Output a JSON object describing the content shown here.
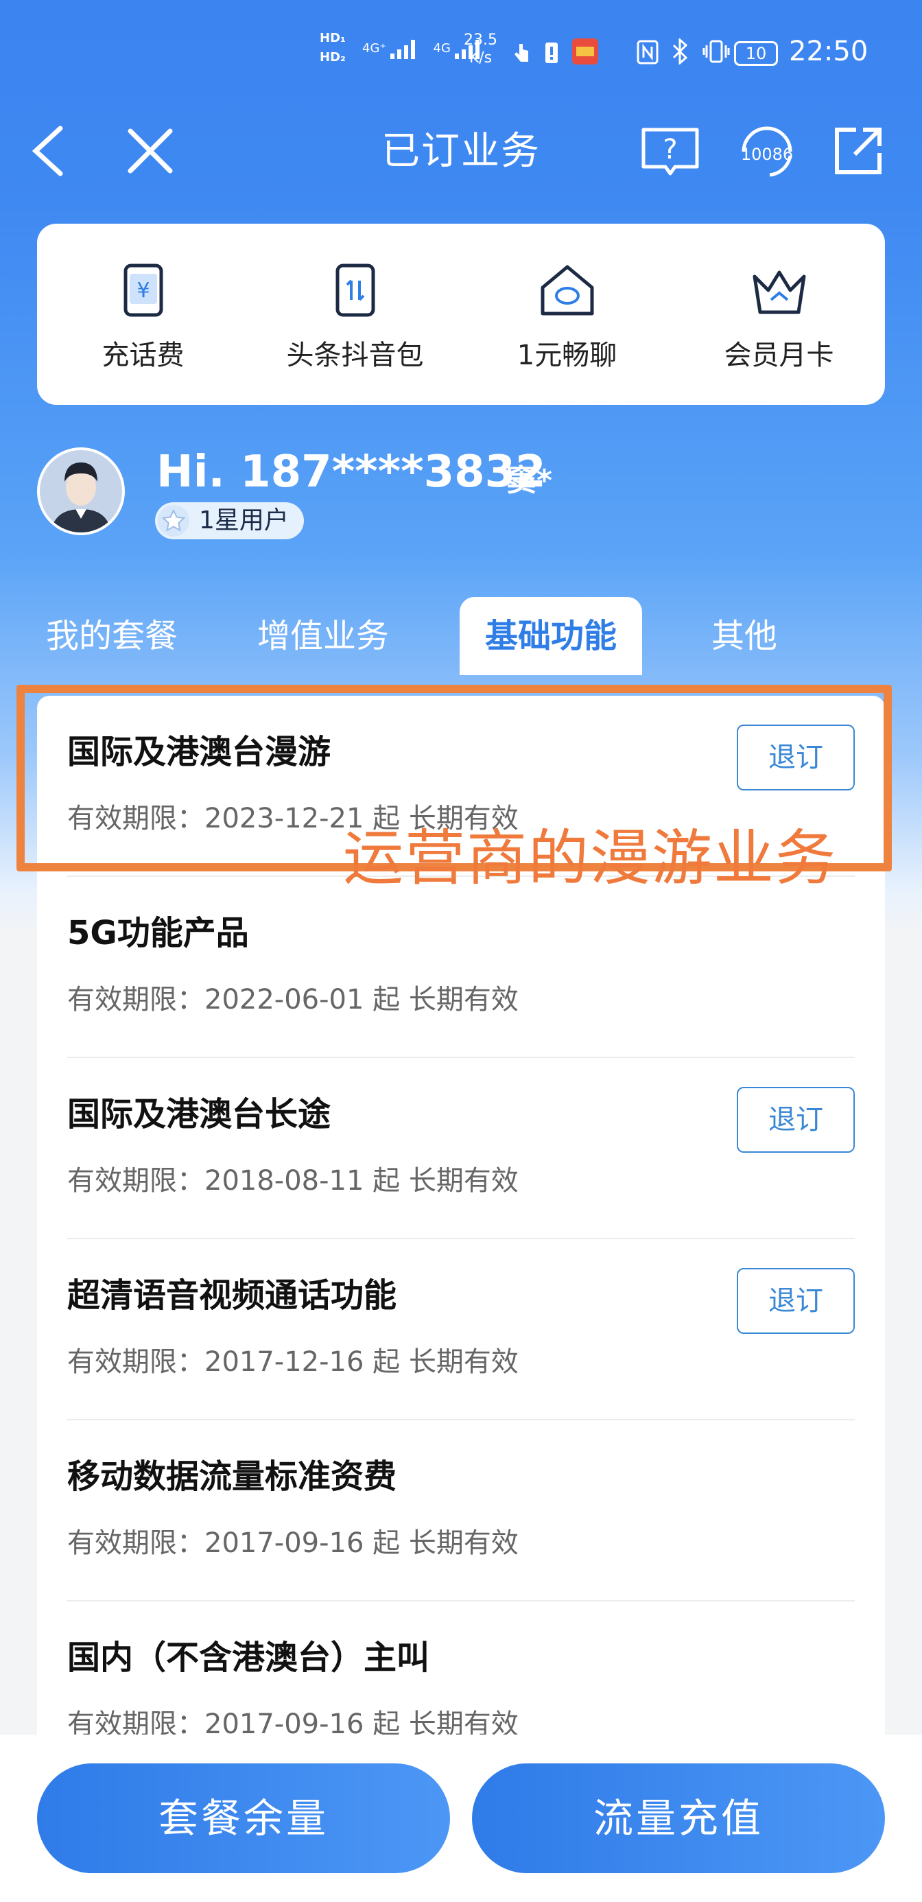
{
  "status_bar": {
    "hd1": "HD₁",
    "hd2": "HD₂",
    "net1": "4G⁺",
    "net2": "4G",
    "speed_value": "23.5",
    "speed_unit": "K/s",
    "battery": "10",
    "time": "22:50"
  },
  "nav": {
    "title": "已订业务",
    "service_number": "10086"
  },
  "quick_menu": [
    {
      "label": "充话费",
      "icon": "phone-yuan-icon"
    },
    {
      "label": "头条抖音包",
      "icon": "phone-transfer-icon"
    },
    {
      "label": "1元畅聊",
      "icon": "home-chat-icon"
    },
    {
      "label": "会员月卡",
      "icon": "crown-icon"
    }
  ],
  "user": {
    "greeting": "Hi. 187****3832",
    "name": "窦*",
    "level": "1星用户"
  },
  "tabs": [
    {
      "label": "我的套餐",
      "active": false
    },
    {
      "label": "增值业务",
      "active": false
    },
    {
      "label": "基础功能",
      "active": true
    },
    {
      "label": "其他",
      "active": false
    }
  ],
  "services": [
    {
      "title": "国际及港澳台漫游",
      "date": "有效期限：2023-12-21 起 长期有效",
      "action": "退订"
    },
    {
      "title": "5G功能产品",
      "date": "有效期限：2022-06-01 起 长期有效",
      "action": ""
    },
    {
      "title": "国际及港澳台长途",
      "date": "有效期限：2018-08-11 起 长期有效",
      "action": "退订"
    },
    {
      "title": "超清语音视频通话功能",
      "date": "有效期限：2017-12-16 起 长期有效",
      "action": "退订"
    },
    {
      "title": "移动数据流量标准资费",
      "date": "有效期限：2017-09-16 起 长期有效",
      "action": ""
    },
    {
      "title": "国内（不含港澳台）主叫",
      "date": "有效期限：2017-09-16 起 长期有效",
      "action": ""
    }
  ],
  "annotation": "运营商的漫游业务",
  "bottom": {
    "left_button": "套餐余量",
    "right_button": "流量充值"
  },
  "colors": {
    "brand_blue": "#3c84f0",
    "annotation_orange": "#ee8340",
    "outline_blue": "#3a87d6"
  }
}
